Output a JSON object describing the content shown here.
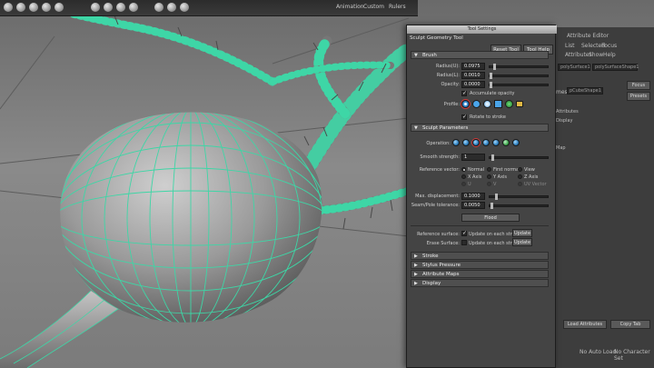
{
  "shelf": {
    "tabs": [
      "Animation",
      "Custom",
      "Rulers"
    ]
  },
  "tool_window": {
    "title": "Tool Settings",
    "tool_name": "Sculpt Geometry Tool",
    "reset_label": "Reset Tool",
    "help_label": "Tool Help",
    "brush": {
      "header": "Brush",
      "radius_u_label": "Radius(U):",
      "radius_u_value": "0.0975",
      "radius_l_label": "Radius(L):",
      "radius_l_value": "0.0010",
      "opacity_label": "Opacity:",
      "opacity_value": "0.0000",
      "accumulate_label": "Accumulate opacity",
      "profile_label": "Profile:",
      "rotate_label": "Rotate to stroke"
    },
    "sculpt": {
      "header": "Sculpt Parameters",
      "operation_label": "Operation:",
      "smooth_label": "Smooth strength:",
      "smooth_value": "1",
      "reference_label": "Reference vector:",
      "ref_options": [
        "Normal",
        "First normal",
        "View",
        "X Axis",
        "Y Axis",
        "Z Axis",
        "U",
        "V",
        "UV Vector"
      ],
      "max_disp_label": "Max. displacement:",
      "max_disp_value": "0.1000",
      "seam_label": "Seam/Pole tolerance:",
      "seam_value": "0.0050",
      "flood_label": "Flood",
      "ref_surface_label": "Reference surface:",
      "ref_surface_check": "Update on each stroke",
      "update_label": "Update",
      "erase_surface_label": "Erase Surface:",
      "erase_surface_check": "Update on each stroke"
    },
    "collapsed_sections": [
      "Stroke",
      "Stylus Pressure",
      "Attribute Maps",
      "Display"
    ]
  },
  "attribute_panel": {
    "tabs": [
      "Attribute Editor",
      "List",
      "Selected",
      "Focus",
      "Attributes",
      "Show",
      "Help"
    ],
    "node_field": "polySurface1",
    "node_field2": "polySurfaceShape1",
    "mesh_label": "mesh:",
    "mesh_value": "pCubeShape1",
    "focus_btn": "Focus",
    "presets_btn": "Presets",
    "list_items": [
      "Attributes",
      "Display",
      "Map"
    ],
    "load_btn": "Load Attributes",
    "copy_btn": "Copy Tab",
    "auto_label": "No Auto Load",
    "char_label": "No Character Set"
  }
}
